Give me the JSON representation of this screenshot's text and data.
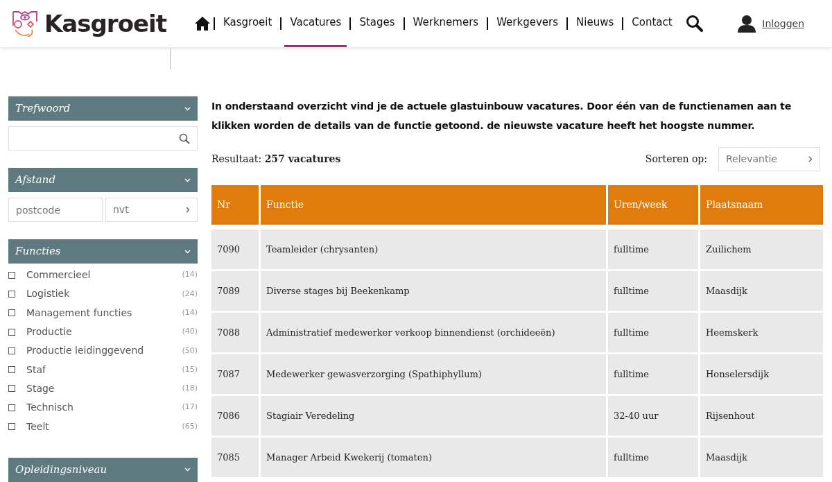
{
  "header": {
    "logo": "Kasgroeit",
    "nav": [
      {
        "label": "Kasgroeit",
        "selected": false
      },
      {
        "label": "Vacatures",
        "selected": true
      },
      {
        "label": "Stages",
        "selected": false
      },
      {
        "label": "Werknemers",
        "selected": false
      },
      {
        "label": "Werkgevers",
        "selected": false
      },
      {
        "label": "Nieuws",
        "selected": false
      },
      {
        "label": "Contact",
        "selected": false
      }
    ],
    "login": "Inloggen"
  },
  "sidebar": {
    "keyword": {
      "title": "Trefwoord"
    },
    "distance": {
      "title": "Afstand",
      "placeholder": "postcode",
      "select": "nvt"
    },
    "functions": {
      "title": "Functies",
      "items": [
        {
          "label": "Commercieel",
          "count": "(14)",
          "checked": false
        },
        {
          "label": "Logistiek",
          "count": "(24)",
          "checked": false
        },
        {
          "label": "Management functies",
          "count": "(14)",
          "checked": false
        },
        {
          "label": "Productie",
          "count": "(40)",
          "checked": false
        },
        {
          "label": "Productie leidinggevend",
          "count": "(50)",
          "checked": false
        },
        {
          "label": "Staf",
          "count": "(15)",
          "checked": false
        },
        {
          "label": "Stage",
          "count": "(18)",
          "checked": false
        },
        {
          "label": "Technisch",
          "count": "(17)",
          "checked": false
        },
        {
          "label": "Teelt",
          "count": "(65)",
          "checked": false
        }
      ]
    },
    "education": {
      "title": "Opleidingsniveau"
    }
  },
  "intro": "In onderstaand overzicht vind je de actuele glastuinbouw vacatures. Door één van de functienamen aan te klikken worden de details van de functie getoond. de nieuwste vacature heeft het hoogste nummer.",
  "result": "Resultaat: **257 vacatures**",
  "sort": {
    "label": "Sorteren op:",
    "value": "Relevantie"
  },
  "table": {
    "columns": [
      "Nr",
      "Functie",
      "Uren/week",
      "Plaatsnaam"
    ],
    "rows": [
      [
        "7090",
        "Teamleider (chrysanten)",
        "fulltime",
        "Zuilichem"
      ],
      [
        "7089",
        "Diverse stages bij Beekenkamp",
        "fulltime",
        "Maasdijk"
      ],
      [
        "7088",
        "Administratief medewerker verkoop binnendienst (orchideeën)",
        "fulltime",
        "Heemskerk"
      ],
      [
        "7087",
        "Medewerker gewasverzorging (Spathiphyllum)",
        "fulltime",
        "Honselersdijk"
      ],
      [
        "7086",
        "Stagiair Veredeling",
        "32-40 uur",
        "Rijsenhout"
      ],
      [
        "7085",
        "Manager Arbeid Kwekerij (tomaten)",
        "fulltime",
        "Maasdijk"
      ]
    ]
  }
}
